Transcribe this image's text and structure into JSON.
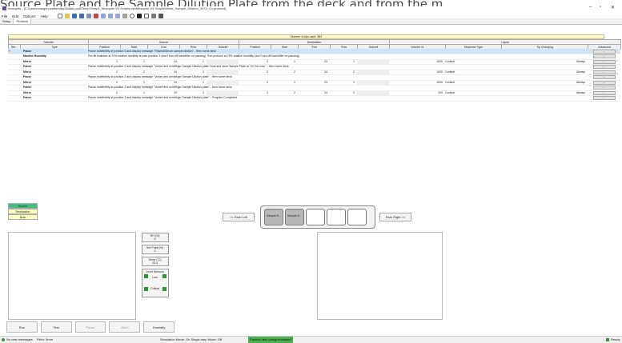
{
  "caption_text": "Source Plate and the Sample Dilution Plate from the deck and from the m",
  "window": {
    "title": "mosquito - [C:\\Users\\vaughn.walker\\AppData\\Local\\Temp\\Temp1_Mosquito V4 Scripts.zip\\Mosquito V4 Scripts\\Dilink_Sample_Dilution_3072_V4.protocol]",
    "minimize": "–",
    "maximize": "▫",
    "close": "✕"
  },
  "menu": [
    "File",
    "Edit",
    "Options",
    "Help"
  ],
  "tabs": [
    "Setup",
    "Protocol"
  ],
  "tips_used": "Number of tips used: 384",
  "group_headers": {
    "transfer": "Transfer",
    "source": "Source",
    "destination": "Destination",
    "liquid": "Liquid"
  },
  "columns": [
    "Ste...",
    "Type",
    "Position",
    "Start",
    "End",
    "Row",
    "Subcell",
    "Position",
    "Start",
    "End",
    "Row",
    "Subcell",
    "Volume nL",
    "Dispense Type",
    "Tip Changing",
    "Advanced"
  ],
  "rows": [
    {
      "type": "Pause",
      "msg": "Pause indefinitely at position 3 and display message \"Plasma/Serum sample dilution\" - then home deck",
      "selected": true
    },
    {
      "type": "Monitor Humidity",
      "msg": "Pre-fill chamber at 70% relative humidity at park position 3 (don't turn off humidifier on pausing). Run protocol at 70% relative humidity (don't turn off humidifier on pausing)"
    },
    {
      "type": "Mirror",
      "src": [
        "1",
        "1",
        "24",
        "1",
        ""
      ],
      "dst": [
        "2",
        "1",
        "23",
        "1",
        ""
      ],
      "vol": "1000",
      "disp": "Contact",
      "tip": "Always"
    },
    {
      "type": "Pause",
      "msg": "Pause indefinitely at position 3 and display message \"Vortex and centrifuge Sample Dilution plate! Seal and store Sample Plate at +4C for now.\" - then home deck"
    },
    {
      "type": "Mirror",
      "src": [
        "2",
        "2",
        "24",
        "2",
        ""
      ],
      "dst": [
        "2",
        "2",
        "24",
        "2",
        ""
      ],
      "vol": "1000",
      "disp": "Contact",
      "tip": "Always"
    },
    {
      "type": "Pause",
      "msg": "Pause indefinitely at position 3 and display message \"Vortex and centrifuge Sample Dilution plate\" - then home deck"
    },
    {
      "type": "Mirror",
      "src": [
        "2",
        "1",
        "24",
        "1",
        ""
      ],
      "dst": [
        "2",
        "1",
        "23",
        "2",
        ""
      ],
      "vol": "1000",
      "disp": "Contact",
      "tip": "Always"
    },
    {
      "type": "Pause",
      "msg": "Pause indefinitely at position 3 and display message \"Vortex and centrifuge Sample Dilution plate\" - then home deck"
    },
    {
      "type": "Mirror",
      "src": [
        "2",
        "1",
        "24",
        "2",
        ""
      ],
      "dst": [
        "2",
        "2",
        "24",
        "2",
        ""
      ],
      "vol": "200",
      "disp": "Contact",
      "tip": "Always"
    },
    {
      "type": "Pause",
      "msg": "Pause indefinitely at position 3 and display message \"Vortex and centrifuge Sample Dilution plate\" - Program Completed"
    }
  ],
  "advanced_label": "...",
  "legend": [
    "Source",
    "Destination",
    "Both"
  ],
  "park_left": "<< Park Left",
  "park_right": "Park Right >>",
  "slots": [
    "Sample S...",
    "Sample D...",
    "",
    "",
    ""
  ],
  "status": {
    "rh_label": "RH (%)",
    "rh_value": "0",
    "setpoint_label": "Set Point (%)",
    "setpoint_value": "0",
    "temp_label": "Temp (°C)",
    "temp_value": "23.4",
    "level_label": "Level Sensors",
    "low": "Low",
    "critical": "Critical"
  },
  "buttons": [
    "Run",
    "Test",
    "Pause",
    "Abort",
    "Humidify"
  ],
  "statusbar": {
    "messages": "No new messages",
    "pitch": "Pitch: 9mm",
    "sim": "Simulation Mode: On  Single-step Mode: Off",
    "user": "Factory user (vaughn.walker)",
    "ready": "Ready"
  },
  "colors": {
    "legend_source": "#3fbf7f",
    "legend_destination": "#ffffc0",
    "legend_both": "#ffffc0",
    "user_badge": "#4caf50",
    "ready_icon": "#2a9a2a"
  }
}
